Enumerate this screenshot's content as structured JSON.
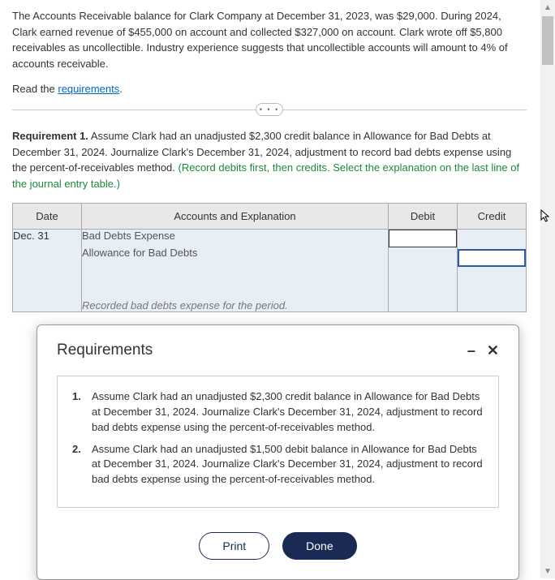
{
  "problem_text": "The Accounts Receivable balance for Clark Company at December 31, 2023, was $29,000. During 2024, Clark earned revenue of $455,000 on account and collected $327,000 on account. Clark wrote off $5,800 receivables as uncollectible. Industry experience suggests that uncollectible accounts will amount to 4% of accounts receivable.",
  "read_prefix": "Read the ",
  "read_link": "requirements",
  "read_suffix": ".",
  "divider_icon": "• • •",
  "requirement1": {
    "label": "Requirement 1.",
    "text": " Assume Clark had an unadjusted $2,300 credit balance in Allowance for Bad Debts at December 31, 2024. Journalize Clark's December 31, 2024, adjustment to record bad debts expense using the percent-of-receivables method.",
    "instruction": " (Record debits first, then credits. Select the explanation on the last line of the journal entry table.)"
  },
  "table": {
    "headers": {
      "date": "Date",
      "accounts": "Accounts and Explanation",
      "debit": "Debit",
      "credit": "Credit"
    },
    "row": {
      "date": "Dec. 31",
      "account1": "Bad Debts Expense",
      "account2": "Allowance for Bad Debts",
      "explanation": "Recorded bad debts expense for the period.",
      "debit_value": "",
      "credit_value": ""
    }
  },
  "modal": {
    "title": "Requirements",
    "minimize": "–",
    "close": "✕",
    "items": [
      {
        "num": "1.",
        "text": "Assume Clark had an unadjusted $2,300 credit balance in Allowance for Bad Debts at December 31, 2024. Journalize Clark's December 31, 2024, adjustment to record bad debts expense using the percent-of-receivables method."
      },
      {
        "num": "2.",
        "text": "Assume Clark had an unadjusted $1,500 debit balance in Allowance for Bad Debts at December 31, 2024. Journalize Clark's December 31, 2024, adjustment to record bad debts expense using the percent-of-receivables method."
      }
    ],
    "print": "Print",
    "done": "Done"
  }
}
